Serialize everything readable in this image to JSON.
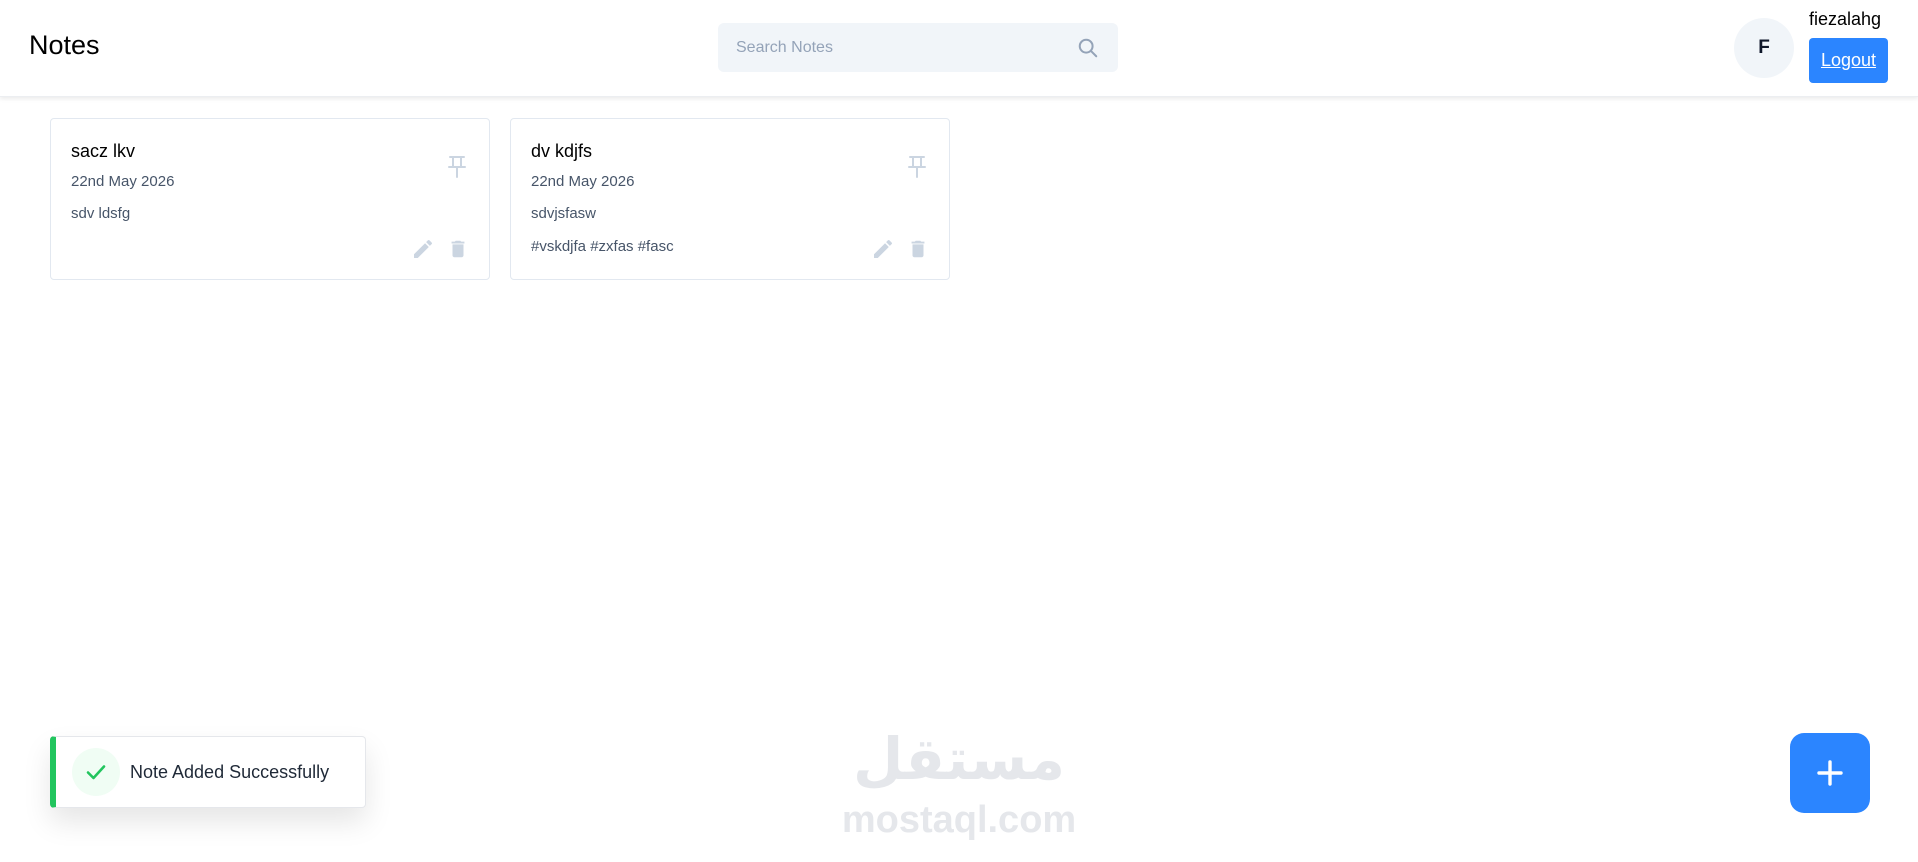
{
  "navbar": {
    "title": "Notes",
    "search": {
      "placeholder": "Search Notes",
      "value": ""
    },
    "user": {
      "initial": "F",
      "name": "fiezalahg"
    },
    "logout_label": "Logout"
  },
  "notes": [
    {
      "title": "sacz lkv",
      "date": "22nd May 2026",
      "content": "sdv ldsfg",
      "tags": ""
    },
    {
      "title": "dv kdjfs",
      "date": "22nd May 2026",
      "content": "sdvjsfasw",
      "tags": "#vskdjfa #zxfas #fasc"
    }
  ],
  "toast": {
    "message": "Note Added Successfully"
  },
  "watermark": {
    "arabic": "مستقل",
    "latin": "mostaql.com"
  },
  "colors": {
    "accent": "#2b85ff",
    "success": "#22c55e",
    "icon_muted": "#cbd5e1"
  },
  "icons": {
    "search": "search-icon",
    "pin": "pin-icon",
    "edit": "edit-icon",
    "delete": "delete-icon",
    "check": "check-icon",
    "add": "plus-icon"
  }
}
